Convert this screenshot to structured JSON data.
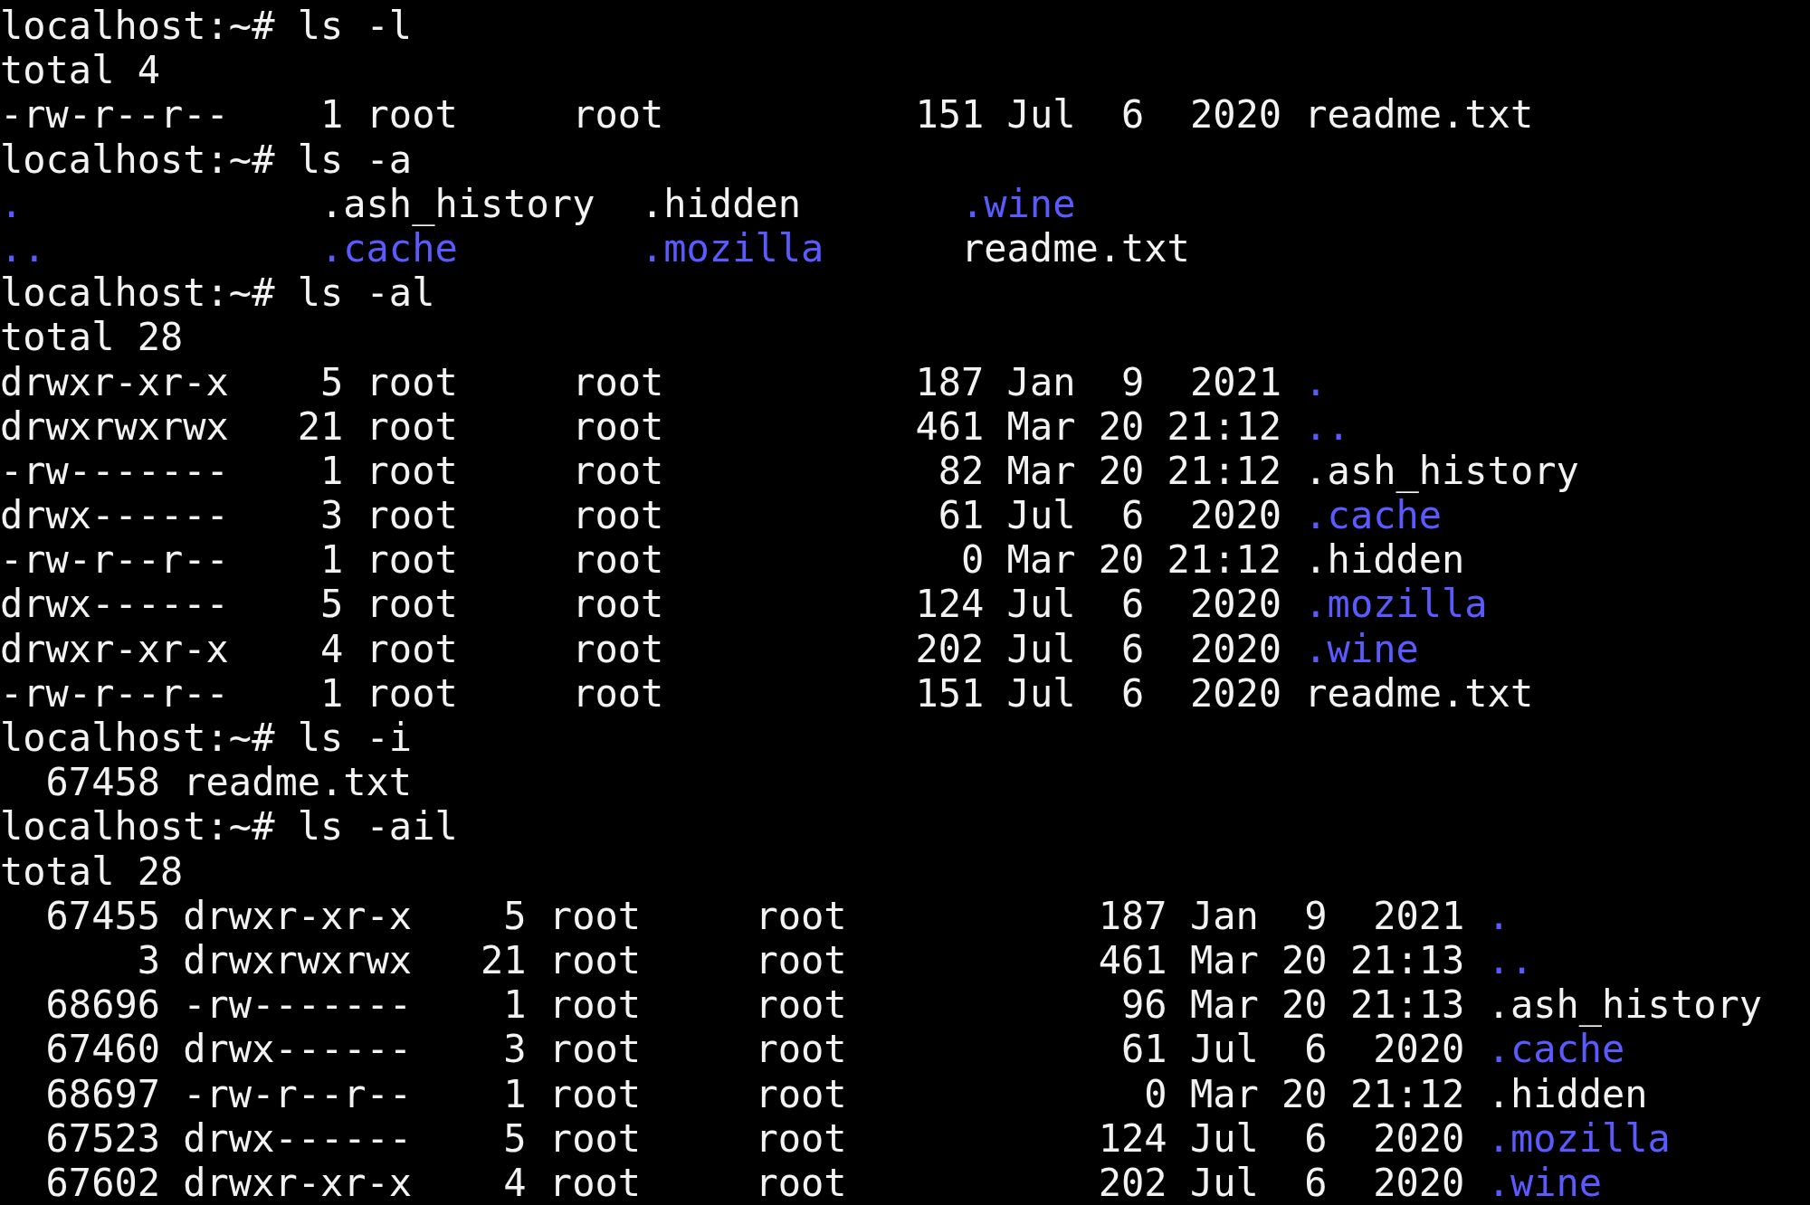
{
  "terminal": {
    "lines": [
      {
        "segments": [
          {
            "kind": "prompt",
            "text": "localhost:~# ls -l"
          }
        ]
      },
      {
        "segments": [
          {
            "kind": "plain",
            "text": "total 4"
          }
        ]
      },
      {
        "segments": [
          {
            "kind": "plain",
            "text": "-rw-r--r--    1 root     root           151 Jul  6  2020 "
          },
          {
            "kind": "plain",
            "text": "readme.txt"
          }
        ]
      },
      {
        "segments": [
          {
            "kind": "prompt",
            "text": "localhost:~# ls -a"
          }
        ]
      },
      {
        "kind": "columns",
        "segments": [
          {
            "kind": "dir",
            "text": "."
          },
          {
            "kind": "plain",
            "text": ".ash_history"
          },
          {
            "kind": "plain",
            "text": ".hidden"
          },
          {
            "kind": "dir",
            "text": ".wine"
          }
        ]
      },
      {
        "kind": "columns",
        "segments": [
          {
            "kind": "dir",
            "text": ".."
          },
          {
            "kind": "dir",
            "text": ".cache"
          },
          {
            "kind": "dir",
            "text": ".mozilla"
          },
          {
            "kind": "plain",
            "text": "readme.txt"
          }
        ]
      },
      {
        "segments": [
          {
            "kind": "prompt",
            "text": "localhost:~# ls -al"
          }
        ]
      },
      {
        "segments": [
          {
            "kind": "plain",
            "text": "total 28"
          }
        ]
      },
      {
        "segments": [
          {
            "kind": "plain",
            "text": "drwxr-xr-x    5 root     root           187 Jan  9  2021 "
          },
          {
            "kind": "dir",
            "text": "."
          }
        ]
      },
      {
        "segments": [
          {
            "kind": "plain",
            "text": "drwxrwxrwx   21 root     root           461 Mar 20 21:12 "
          },
          {
            "kind": "dir",
            "text": ".."
          }
        ]
      },
      {
        "segments": [
          {
            "kind": "plain",
            "text": "-rw-------    1 root     root            82 Mar 20 21:12 "
          },
          {
            "kind": "plain",
            "text": ".ash_history"
          }
        ]
      },
      {
        "segments": [
          {
            "kind": "plain",
            "text": "drwx------    3 root     root            61 Jul  6  2020 "
          },
          {
            "kind": "dir",
            "text": ".cache"
          }
        ]
      },
      {
        "segments": [
          {
            "kind": "plain",
            "text": "-rw-r--r--    1 root     root             0 Mar 20 21:12 "
          },
          {
            "kind": "plain",
            "text": ".hidden"
          }
        ]
      },
      {
        "segments": [
          {
            "kind": "plain",
            "text": "drwx------    5 root     root           124 Jul  6  2020 "
          },
          {
            "kind": "dir",
            "text": ".mozilla"
          }
        ]
      },
      {
        "segments": [
          {
            "kind": "plain",
            "text": "drwxr-xr-x    4 root     root           202 Jul  6  2020 "
          },
          {
            "kind": "dir",
            "text": ".wine"
          }
        ]
      },
      {
        "segments": [
          {
            "kind": "plain",
            "text": "-rw-r--r--    1 root     root           151 Jul  6  2020 "
          },
          {
            "kind": "plain",
            "text": "readme.txt"
          }
        ]
      },
      {
        "segments": [
          {
            "kind": "prompt",
            "text": "localhost:~# ls -i"
          }
        ]
      },
      {
        "segments": [
          {
            "kind": "plain",
            "text": "  67458 readme.txt"
          }
        ]
      },
      {
        "segments": [
          {
            "kind": "prompt",
            "text": "localhost:~# ls -ail"
          }
        ]
      },
      {
        "segments": [
          {
            "kind": "plain",
            "text": "total 28"
          }
        ]
      },
      {
        "segments": [
          {
            "kind": "plain",
            "text": "  67455 drwxr-xr-x    5 root     root           187 Jan  9  2021 "
          },
          {
            "kind": "dir",
            "text": "."
          }
        ]
      },
      {
        "segments": [
          {
            "kind": "plain",
            "text": "      3 drwxrwxrwx   21 root     root           461 Mar 20 21:13 "
          },
          {
            "kind": "dir",
            "text": ".."
          }
        ]
      },
      {
        "segments": [
          {
            "kind": "plain",
            "text": "  68696 -rw-------    1 root     root            96 Mar 20 21:13 "
          },
          {
            "kind": "plain",
            "text": ".ash_history"
          }
        ]
      },
      {
        "segments": [
          {
            "kind": "plain",
            "text": "  67460 drwx------    3 root     root            61 Jul  6  2020 "
          },
          {
            "kind": "dir",
            "text": ".cache"
          }
        ]
      },
      {
        "segments": [
          {
            "kind": "plain",
            "text": "  68697 -rw-r--r--    1 root     root             0 Mar 20 21:12 "
          },
          {
            "kind": "plain",
            "text": ".hidden"
          }
        ]
      },
      {
        "segments": [
          {
            "kind": "plain",
            "text": "  67523 drwx------    5 root     root           124 Jul  6  2020 "
          },
          {
            "kind": "dir",
            "text": ".mozilla"
          }
        ]
      },
      {
        "segments": [
          {
            "kind": "plain",
            "text": "  67602 drwxr-xr-x    4 root     root           202 Jul  6  2020 "
          },
          {
            "kind": "dir",
            "text": ".wine"
          }
        ]
      }
    ]
  }
}
